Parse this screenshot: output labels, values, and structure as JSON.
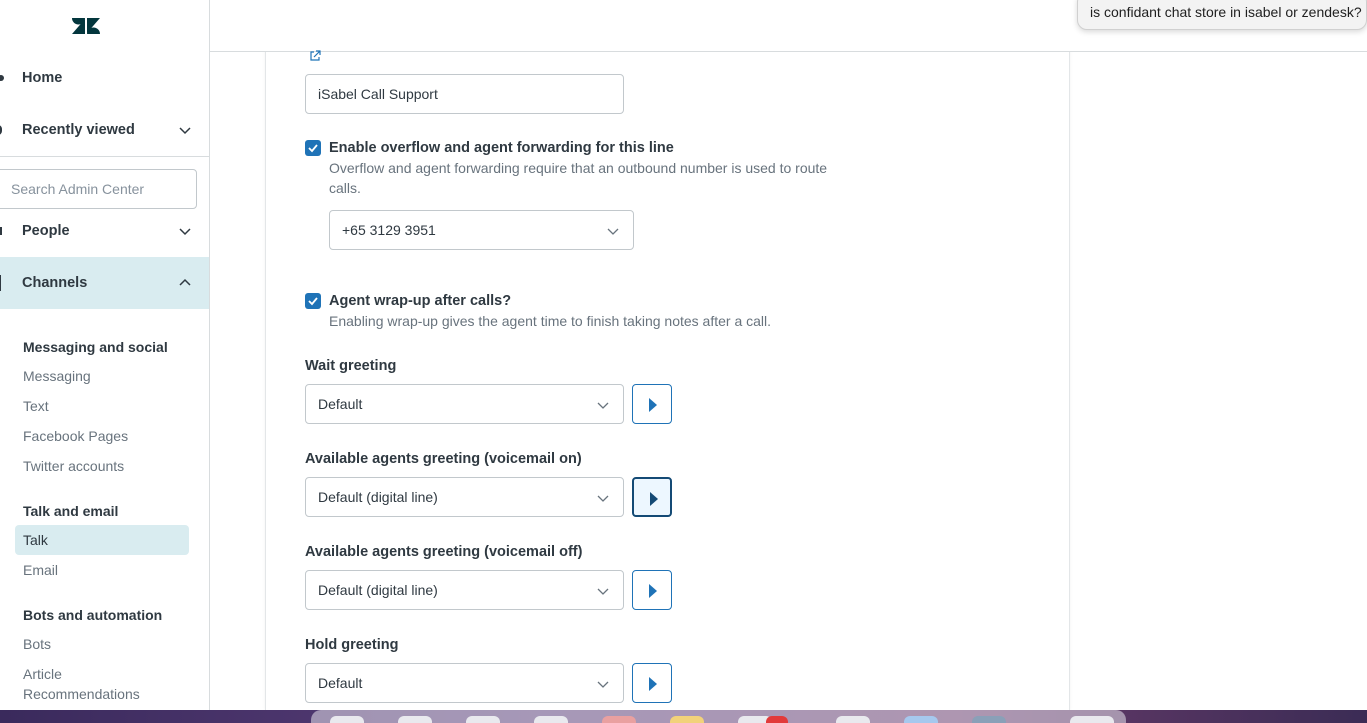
{
  "sidebar": {
    "home_label": "Home",
    "recently_viewed_label": "Recently viewed",
    "search_placeholder": "Search Admin Center",
    "people_label": "People",
    "channels_label": "Channels",
    "sections": {
      "messaging_social": {
        "title": "Messaging and social",
        "items": [
          "Messaging",
          "Text",
          "Facebook Pages",
          "Twitter accounts"
        ]
      },
      "talk_email": {
        "title": "Talk and email",
        "items": [
          "Talk",
          "Email"
        ]
      },
      "bots_automation": {
        "title": "Bots and automation",
        "items": [
          "Bots",
          "Article",
          "Recommendations"
        ]
      }
    }
  },
  "topbar": {
    "tooltip_text": "is confidant chat store in isabel or zendesk?"
  },
  "form": {
    "line_name_value": "iSabel Call Support",
    "overflow": {
      "label": "Enable overflow and agent forwarding for this line",
      "hint_line1": "Overflow and agent forwarding require that an outbound number is used to route",
      "hint_line2": "calls.",
      "number_value": "+65 3129 3951",
      "checked": true
    },
    "wrapup": {
      "label": "Agent wrap-up after calls?",
      "hint": "Enabling wrap-up gives the agent time to finish taking notes after a call.",
      "checked": true
    },
    "wait_greeting": {
      "label": "Wait greeting",
      "value": "Default"
    },
    "available_on": {
      "label": "Available agents greeting (voicemail on)",
      "value": "Default (digital line)"
    },
    "available_off": {
      "label": "Available agents greeting (voicemail off)",
      "value": "Default (digital line)"
    },
    "hold_greeting": {
      "label": "Hold greeting",
      "value": "Default"
    }
  },
  "colors": {
    "accent": "#1f73b7",
    "active_nav_bg": "#d9ecf0"
  }
}
